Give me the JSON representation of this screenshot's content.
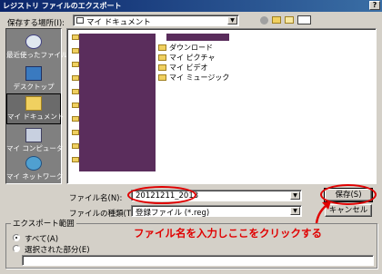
{
  "window": {
    "title": "レジストリ ファイルのエクスポート",
    "help_button": "?"
  },
  "save_location": {
    "label": "保存する場所(I):",
    "value": "マイ ドキュメント"
  },
  "toolbar": {
    "icons": [
      "back-icon",
      "up-folder-icon",
      "new-folder-icon",
      "view-menu-icon"
    ]
  },
  "places": [
    {
      "label": "最近使ったファイル",
      "icon": "recent-files-icon",
      "selected": false
    },
    {
      "label": "デスクトップ",
      "icon": "desktop-icon",
      "selected": false
    },
    {
      "label": "マイ ドキュメント",
      "icon": "my-documents-icon",
      "selected": true
    },
    {
      "label": "マイ コンピュータ",
      "icon": "my-computer-icon",
      "selected": false
    },
    {
      "label": "マイ ネットワーク",
      "icon": "network-icon",
      "selected": false
    }
  ],
  "files": [
    {
      "name": "ダウンロード",
      "icon": "folder-icon"
    },
    {
      "name": "マイ ピクチャ",
      "icon": "folder-icon"
    },
    {
      "name": "マイ ビデオ",
      "icon": "folder-icon"
    },
    {
      "name": "マイ ミュージック",
      "icon": "folder-icon"
    }
  ],
  "filename": {
    "label": "ファイル名(N):",
    "value": "20121211_2013"
  },
  "filetype": {
    "label": "ファイルの種類(T):",
    "value": "登録ファイル (*.reg)"
  },
  "buttons": {
    "save": "保存(S)",
    "cancel": "キャンセル"
  },
  "export_range": {
    "title": "エクスポート範囲",
    "all": "すべて(A)",
    "selected_branch": "選択された部分(E)",
    "branch_value": ""
  },
  "annotation": "ファイル名を入力しここをクリックする",
  "colors": {
    "title_bar": "#0a246a",
    "annotation": "#e00000",
    "redacted_area": "#5a2d5c"
  }
}
